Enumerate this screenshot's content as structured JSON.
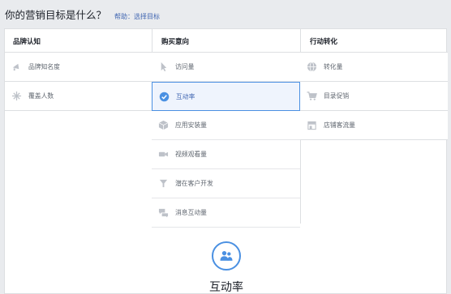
{
  "header": {
    "question": "你的营销目标是什么？",
    "help_link": "帮助：选择目标"
  },
  "columns": [
    {
      "title": "品牌认知",
      "items": [
        {
          "label": "品牌知名度",
          "icon": "megaphone-icon"
        },
        {
          "label": "覆盖人数",
          "icon": "snowflake-reach-icon"
        }
      ]
    },
    {
      "title": "购买意向",
      "items": [
        {
          "label": "访问量",
          "icon": "cursor-icon"
        },
        {
          "label": "互动率",
          "icon": "check-circle-icon",
          "selected": true
        },
        {
          "label": "应用安装量",
          "icon": "box-icon"
        },
        {
          "label": "视频观看量",
          "icon": "video-camera-icon"
        },
        {
          "label": "潜在客户开发",
          "icon": "funnel-icon"
        },
        {
          "label": "消息互动量",
          "icon": "chat-bubbles-icon"
        }
      ]
    },
    {
      "title": "行动转化",
      "items": [
        {
          "label": "转化量",
          "icon": "globe-icon"
        },
        {
          "label": "目录促销",
          "icon": "shopping-cart-icon"
        },
        {
          "label": "店铺客流量",
          "icon": "storefront-icon"
        }
      ]
    }
  ],
  "selected_goal": {
    "title": "互动率",
    "icon": "people-engagement-icon"
  },
  "colors": {
    "accent": "#4a90e2",
    "link": "#4267b2",
    "selected_bg": "#eff4fd",
    "icon_gray": "#bec2c9"
  }
}
